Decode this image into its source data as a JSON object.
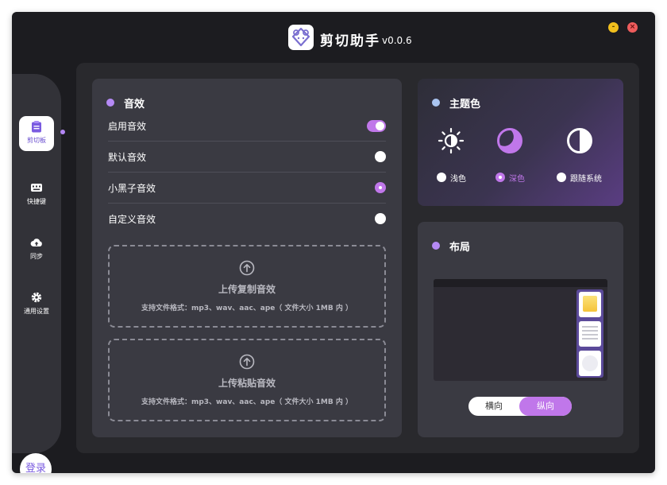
{
  "app": {
    "title": "剪切助手",
    "version": "v0.0.6"
  },
  "window_controls": {
    "minimize": "-",
    "close": "×"
  },
  "sidebar": {
    "items": [
      {
        "label": "剪切板",
        "icon": "clipboard-icon",
        "active": true
      },
      {
        "label": "快捷键",
        "icon": "keyboard-icon",
        "active": false
      },
      {
        "label": "同步",
        "icon": "cloud-upload-icon",
        "active": false
      },
      {
        "label": "通用设置",
        "icon": "gear-icon",
        "active": false
      }
    ],
    "login_label": "登录"
  },
  "sound": {
    "title": "音效",
    "rows": [
      {
        "label": "启用音效",
        "control": "toggle",
        "on": true
      },
      {
        "label": "默认音效",
        "control": "radio",
        "checked": false
      },
      {
        "label": "小黑子音效",
        "control": "radio",
        "checked": true
      },
      {
        "label": "自定义音效",
        "control": "radio",
        "checked": false
      }
    ],
    "upload_copy": {
      "title": "上传复制音效",
      "hint": "支持文件格式：mp3、wav、aac、ape（ 文件大小 1MB 内 ）"
    },
    "upload_paste": {
      "title": "上传粘贴音效",
      "hint": "支持文件格式：mp3、wav、aac、ape（ 文件大小 1MB 内 ）"
    }
  },
  "theme": {
    "title": "主题色",
    "options": [
      {
        "label": "浅色",
        "icon": "sun-icon",
        "selected": false
      },
      {
        "label": "深色",
        "icon": "moon-icon",
        "selected": true
      },
      {
        "label": "跟随系统",
        "icon": "contrast-icon",
        "selected": false
      }
    ]
  },
  "layout": {
    "title": "布局",
    "options": [
      {
        "label": "横向",
        "selected": false
      },
      {
        "label": "纵向",
        "selected": true
      }
    ]
  },
  "colors": {
    "accent": "#c077ea",
    "bullet": "#b58af5",
    "panel": "#3a3a42",
    "window": "#1c1c20"
  }
}
